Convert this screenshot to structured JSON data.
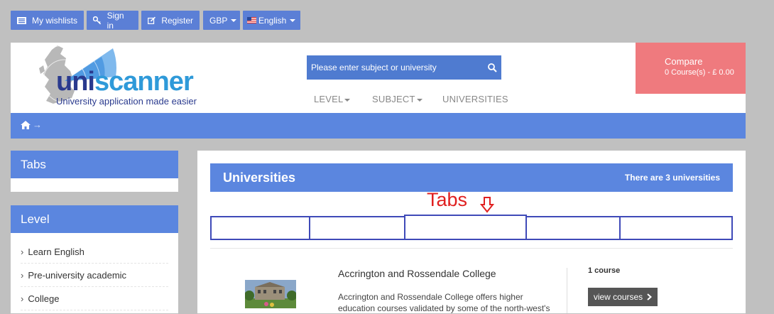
{
  "topbar": {
    "wishlists": "My wishlists",
    "signin": "Sign in",
    "register": "Register",
    "currency": "GBP",
    "language": "English"
  },
  "header": {
    "logo_text": "uniscanner",
    "tagline": "University application made easier",
    "search_placeholder": "Please enter subject or university",
    "nav": [
      "LEVEL",
      "SUBJECT",
      "UNIVERSITIES"
    ],
    "compare_title": "Compare",
    "compare_summary": "0 Course(s) - £ 0.00"
  },
  "breadcrumb": {
    "arrow": "→"
  },
  "sidebar": {
    "tabs_title": "Tabs",
    "level_title": "Level",
    "level_items": [
      "Learn English",
      "Pre-university academic",
      "College"
    ]
  },
  "main": {
    "title": "Universities",
    "count_text": "There are 3 universities",
    "annotation": "Tabs",
    "result": {
      "name": "Accrington and Rossendale College",
      "description": "Accrington and Rossendale College offers higher education courses validated by some of the north-west's",
      "courses": "1 course",
      "view_label": "view courses"
    }
  },
  "colors": {
    "topbar_button": "#5b7fd6",
    "primary_blue": "#5b86df",
    "compare_red": "#ef7a7e",
    "annotation_red": "#e02020",
    "tab_border": "#3f4ab8"
  }
}
